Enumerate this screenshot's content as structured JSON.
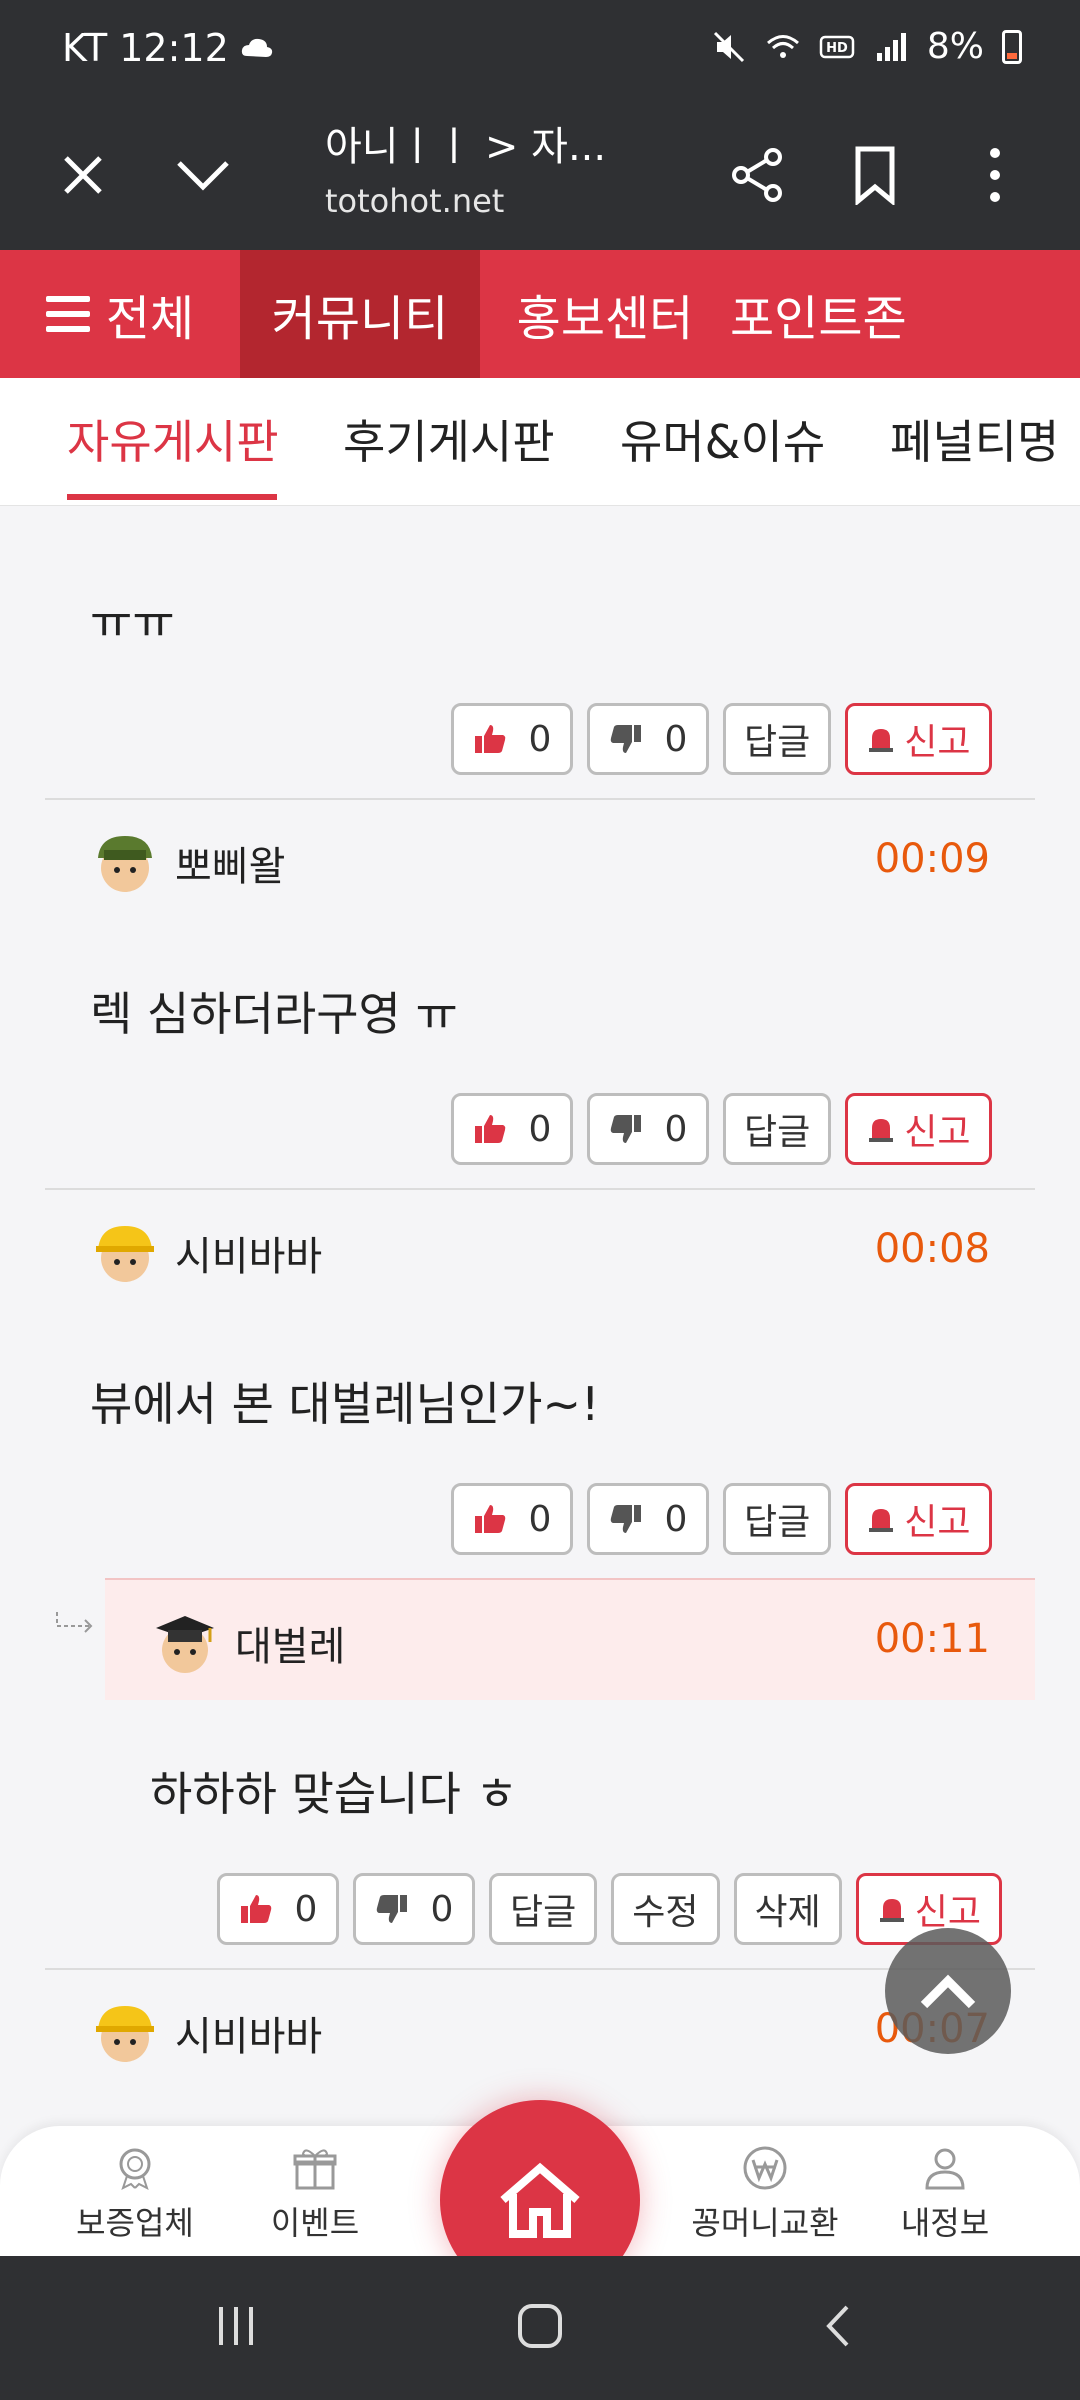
{
  "status_bar": {
    "carrier_time": "KT 12:12",
    "battery": "8%"
  },
  "browser": {
    "title": "아니ㅣㅣ > 자...",
    "url": "totohot.net"
  },
  "main_nav": {
    "all": "전체",
    "items": [
      "커뮤니티",
      "홍보센터",
      "포인트존"
    ],
    "active_index": 0
  },
  "sub_tabs": [
    "자유게시판",
    "후기게시판",
    "유머&이슈",
    "페널티명"
  ],
  "comments": [
    {
      "text": "ㅠㅠ",
      "likes": "0",
      "dislikes": "0"
    },
    {
      "user": "뽀삐왈",
      "time": "00:09",
      "text": "렉 심하더라구영 ㅠ",
      "likes": "0",
      "dislikes": "0"
    },
    {
      "user": "시비바바",
      "time": "00:08",
      "text": "뷰에서 본 대벌레님인가~!",
      "likes": "0",
      "dislikes": "0"
    },
    {
      "user": "대벌레",
      "time": "00:11",
      "text": "하하하 맞습니다 ㅎ",
      "likes": "0",
      "dislikes": "0",
      "reply": true
    },
    {
      "user": "시비바바",
      "time": "00:07"
    }
  ],
  "labels": {
    "reply": "답글",
    "report": "신고",
    "edit": "수정",
    "delete": "삭제"
  },
  "bottom_nav": [
    "보증업체",
    "이벤트",
    "꽁머니교환",
    "내정보"
  ],
  "colors": {
    "brand_red": "#dc3545",
    "time_orange": "#e8590c",
    "dark": "#2f3033"
  }
}
